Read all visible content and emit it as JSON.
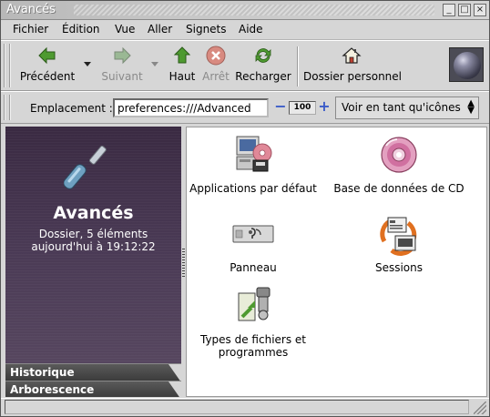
{
  "window": {
    "title": "Avancés"
  },
  "menubar": [
    {
      "label": "Fichier"
    },
    {
      "label": "Édition"
    },
    {
      "label": "Vue"
    },
    {
      "label": "Aller"
    },
    {
      "label": "Signets"
    },
    {
      "label": "Aide"
    }
  ],
  "toolbar": {
    "back": "Précédent",
    "forward": "Suivant",
    "up": "Haut",
    "stop": "Arrêt",
    "reload": "Recharger",
    "home": "Dossier personnel"
  },
  "location": {
    "label": "Emplacement :",
    "value": "preferences:///Advanced",
    "zoom": "100",
    "view_mode": "Voir en tant qu'icônes"
  },
  "sidebar": {
    "title": "Avancés",
    "info_line1": "Dossier, 5 éléments",
    "info_line2": "aujourd'hui à 19:12:22",
    "tabs": [
      {
        "label": "Historique"
      },
      {
        "label": "Arborescence"
      }
    ]
  },
  "items": [
    {
      "name": "Applications par défaut",
      "icon": "default-applications-icon"
    },
    {
      "name": "Base de données de CD",
      "icon": "cd-database-icon"
    },
    {
      "name": "Panneau",
      "icon": "panel-icon"
    },
    {
      "name": "Sessions",
      "icon": "sessions-icon"
    },
    {
      "name": "Types de fichiers et programmes",
      "icon": "file-types-icon"
    }
  ],
  "colors": {
    "sidebar_bg": "#3a2a42",
    "window_bg": "#d6d6d6",
    "content_bg": "#ffffff",
    "accent_blue": "#3a5bc8"
  }
}
